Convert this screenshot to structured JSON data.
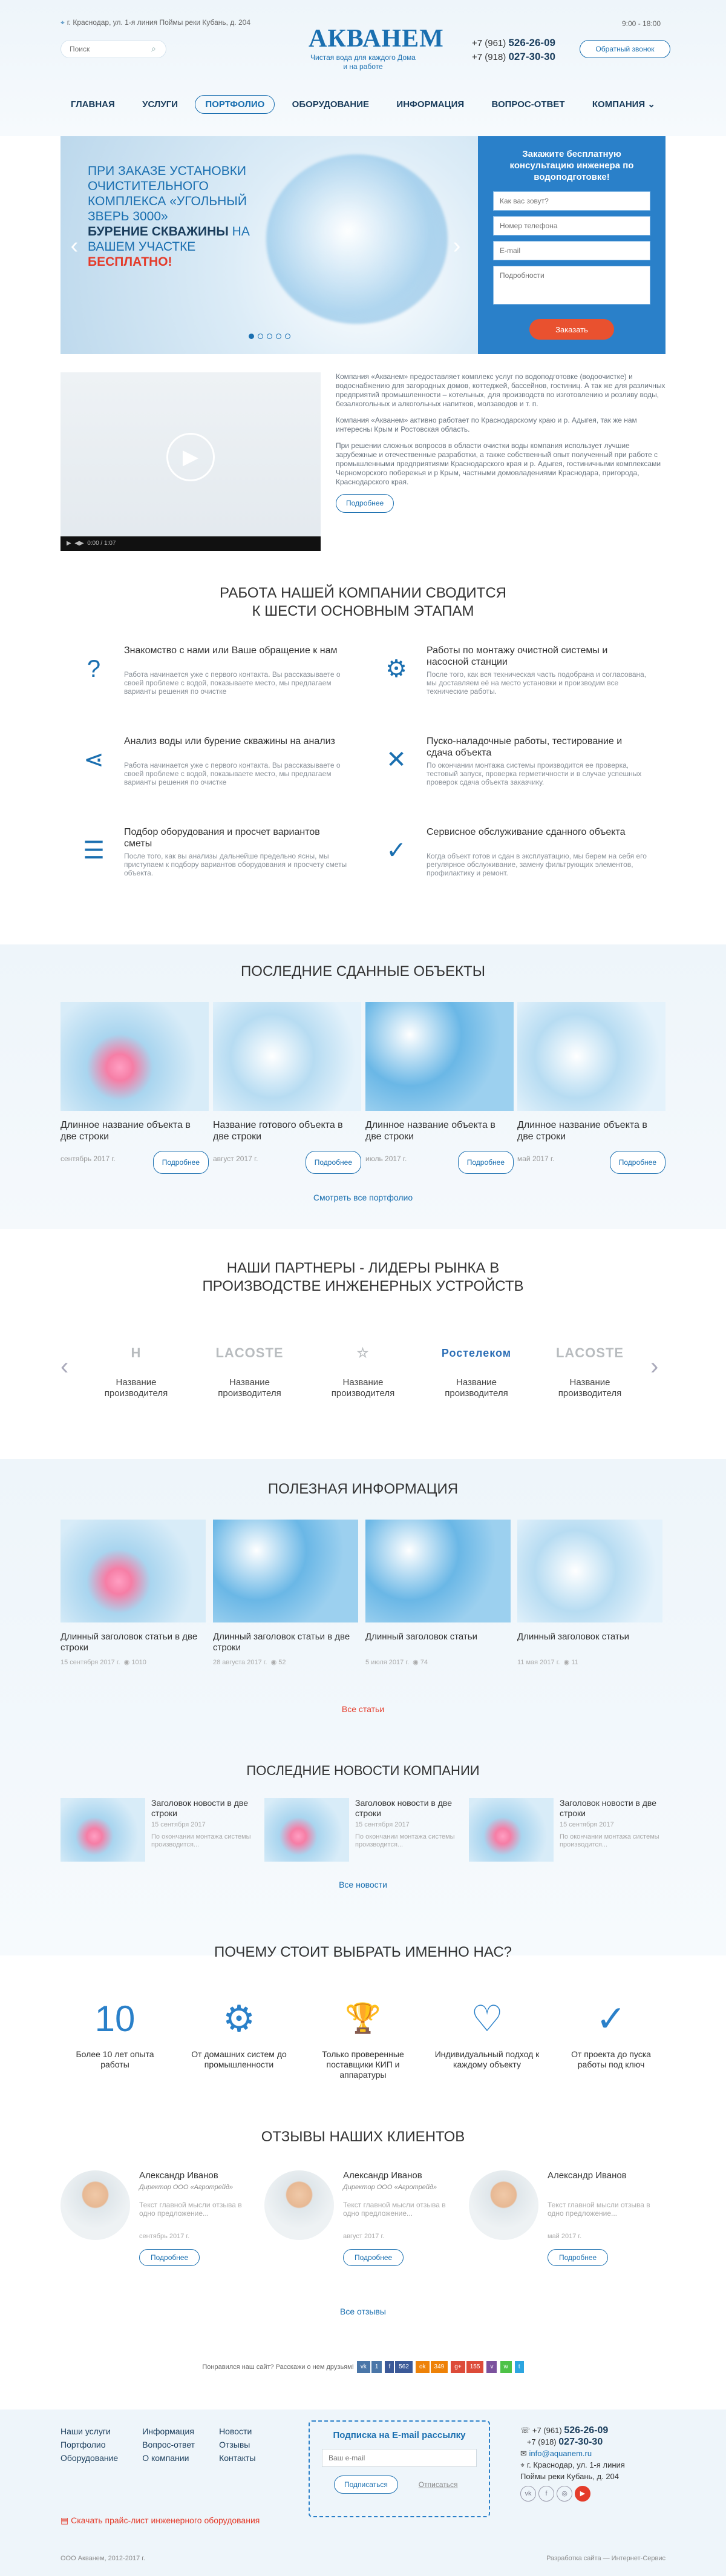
{
  "header": {
    "address": "г. Краснодар, ул. 1-я линия Поймы реки Кубань, д. 204",
    "search_placeholder": "Поиск",
    "logo": "АКВАНЕМ",
    "slogan": "Чистая вода для каждого Дома и на работе",
    "phone1_code": "+7 (961)",
    "phone1": "526-26-09",
    "phone2_code": "+7 (918)",
    "phone2": "027-30-30",
    "hours": "9:00 - 18:00",
    "callback": "Обратный звонок",
    "nav": [
      "ГЛАВНАЯ",
      "УСЛУГИ",
      "ПОРТФОЛИО",
      "ОБОРУДОВАНИЕ",
      "ИНФОРМАЦИЯ",
      "ВОПРОС-ОТВЕТ",
      "КОМПАНИЯ ⌄"
    ]
  },
  "hero": {
    "line1": "ПРИ ЗАКАЗЕ УСТАНОВКИ ОЧИСТИТЕЛЬНОГО КОМПЛЕКСА «УГОЛЬНЫЙ ЗВЕРЬ 3000»",
    "line2": "БУРЕНИЕ СКВАЖИНЫ",
    "line3": " НА ВАШЕМ УЧАСТКЕ",
    "line4": "БЕСПЛАТНО!",
    "form_title": "Закажите бесплатную консультацию инженера по водоподготовке!",
    "f_name": "Как вас зовут?",
    "f_phone": "Номер телефона",
    "f_email": "E-mail",
    "f_details": "Подробности",
    "f_submit": "Заказать"
  },
  "about": {
    "p1": "Компания «Акванем» предоставляет комплекс услуг по водоподготовке (водоочистке) и водоснабжению для загородных домов, коттеджей, бассейнов, гостиниц. А так же для различных предприятий промышленности – котельных, для производств по изготовлению и розливу воды, безалкогольных и алкогольных напитков, молзаводов и т. п.",
    "p2": "Компания «Акванем» активно работает по Краснодарскому краю и р. Адыгея, так же нам интересны Крым и Ростовская область.",
    "p3": "При решении сложных вопросов в области очистки воды компания использует лучшие зарубежные и отечественные разработки, а также собственный опыт полученный при работе с промышленными предприятиями Краснодарского края и р. Адыгея, гостиничными комплексами Черноморского побережья и р Крым, частными домовладениями Краснодара, пригорода, Краснодарского края.",
    "more": "Подробнее",
    "video_time": "0:00 / 1:07"
  },
  "stages": {
    "title1": "РАБОТА НАШЕЙ КОМПАНИИ СВОДИТСЯ",
    "title2": "К ШЕСТИ ОСНОВНЫМ ЭТАПАМ",
    "items": [
      {
        "title": "Знакомство с нами или Ваше обращение к нам",
        "text": "Работа начинается уже с первого контакта. Вы рассказываете о своей проблеме с водой, показываете место, мы предлагаем варианты решения по очистке",
        "icon": "question-icon"
      },
      {
        "title": "Работы по монтажу очистной системы и насосной станции",
        "text": "После того, как вся техническая часть подобрана и согласована, мы доставляем её на место установки и производим все технические работы.",
        "icon": "gear-icon"
      },
      {
        "title": "Анализ воды или бурение скважины на анализ",
        "text": "Работа начинается уже с первого контакта. Вы рассказываете о своей проблеме с водой, показываете место, мы предлагаем варианты решения по очистке",
        "icon": "share-icon"
      },
      {
        "title": "Пуско-наладочные работы, тестирование и сдача объекта",
        "text": "По окончании монтажа системы производится ее проверка, тестовый запуск, проверка герметичности и в случае успешных проверок сдача объекта заказчику.",
        "icon": "tools-icon"
      },
      {
        "title": "Подбор оборудования и просчет вариантов сметы",
        "text": "После того, как вы анализы дальнейше предельно ясны, мы приступаем к подбору вариантов оборудования и просчету сметы объекта.",
        "icon": "clipboard-icon"
      },
      {
        "title": "Сервисное обслуживание сданного объекта",
        "text": "Когда объект готов и сдан в эксплуатацию, мы берем на себя его регулярное обслуживание, замену фильтрующих элементов, профилактику и ремонт.",
        "icon": "check-circle-icon"
      }
    ]
  },
  "objects": {
    "title": "ПОСЛЕДНИЕ СДАННЫЕ ОБЪЕКТЫ",
    "items": [
      {
        "title": "Длинное название объекта в две строки",
        "date": "сентябрь 2017 г.",
        "btn": "Подробнее"
      },
      {
        "title": "Название готового объекта в две строки",
        "date": "август 2017 г.",
        "btn": "Подробнее"
      },
      {
        "title": "Длинное название объекта в две строки",
        "date": "июль 2017 г.",
        "btn": "Подробнее"
      },
      {
        "title": "Длинное название объекта в две строки",
        "date": "май 2017 г.",
        "btn": "Подробнее"
      }
    ],
    "all": "Смотреть все портфолио"
  },
  "partners": {
    "title1": "НАШИ ПАРТНЕРЫ - ЛИДЕРЫ РЫНКА В",
    "title2": "ПРОИЗВОДСТВЕ ИНЖЕНЕРНЫХ УСТРОЙСТВ",
    "items": [
      {
        "logo": "H",
        "name": "Название производителя"
      },
      {
        "logo": "LACOSTE",
        "name": "Название производителя"
      },
      {
        "logo": "☆",
        "name": "Название производителя"
      },
      {
        "logo": "Ростелеком",
        "name": "Название производителя"
      },
      {
        "logo": "LACOSTE",
        "name": "Название производителя"
      }
    ]
  },
  "info": {
    "title": "ПОЛЕЗНАЯ ИНФОРМАЦИЯ",
    "items": [
      {
        "title": "Длинный заголовок статьи в две строки",
        "date": "15 сентября 2017 г.",
        "views": "1010"
      },
      {
        "title": "Длинный заголовок статьи в две строки",
        "date": "28 августа 2017 г.",
        "views": "52"
      },
      {
        "title": "Длинный заголовок статьи",
        "date": "5 июля 2017 г.",
        "views": "74"
      },
      {
        "title": "Длинный заголовок статьи",
        "date": "11 мая 2017 г.",
        "views": "11"
      }
    ],
    "all": "Все статьи"
  },
  "news": {
    "title": "ПОСЛЕДНИЕ НОВОСТИ КОМПАНИИ",
    "items": [
      {
        "title": "Заголовок новости в две строки",
        "date": "15 сентября 2017",
        "text": "По окончании монтажа системы производится..."
      },
      {
        "title": "Заголовок новости в две строки",
        "date": "15 сентября 2017",
        "text": "По окончании монтажа системы производится..."
      },
      {
        "title": "Заголовок новости в две строки",
        "date": "15 сентября 2017",
        "text": "По окончании монтажа системы производится..."
      }
    ],
    "all": "Все новости"
  },
  "why": {
    "title": "ПОЧЕМУ СТОИТ ВЫБРАТЬ ИМЕННО НАС?",
    "items": [
      {
        "icon": "10",
        "text": "Более 10 лет опыта работы"
      },
      {
        "icon": "⚙",
        "text": "От домашних систем до промышленности"
      },
      {
        "icon": "🏆",
        "text": "Только проверенные поставщики КИП и аппаратуры"
      },
      {
        "icon": "♡",
        "text": "Индивидуальный подход к каждому объекту"
      },
      {
        "icon": "✓",
        "text": "От проекта до пуска работы под ключ"
      }
    ]
  },
  "reviews": {
    "title": "ОТЗЫВЫ НАШИХ КЛИЕНТОВ",
    "items": [
      {
        "name": "Александр Иванов",
        "role": "Директор ООО «Агротрейд»",
        "text": "Текст главной мысли отзыва в одно предложение...",
        "date": "сентябрь 2017 г.",
        "btn": "Подробнее"
      },
      {
        "name": "Александр Иванов",
        "role": "Директор ООО «Агротрейд»",
        "text": "Текст главной мысли отзыва в одно предложение...",
        "date": "август 2017 г.",
        "btn": "Подробнее"
      },
      {
        "name": "Александр Иванов",
        "role": "",
        "text": "Текст главной мысли отзыва в одно предложение...",
        "date": "май 2017 г.",
        "btn": "Подробнее"
      }
    ],
    "all": "Все отзывы"
  },
  "share": {
    "text": "Понравился наш сайт? Расскажи о нем друзьям!",
    "counts": [
      "1",
      "562",
      "349",
      "155"
    ]
  },
  "footer": {
    "col1": [
      "Наши услуги",
      "Портфолио",
      "Оборудование"
    ],
    "col2": [
      "Информация",
      "Вопрос-ответ",
      "О компании"
    ],
    "col3": [
      "Новости",
      "Отзывы",
      "Контакты"
    ],
    "sub_title": "Подписка на E-mail рассылку",
    "sub_placeholder": "Ваш e-mail",
    "sub_btn": "Подписаться",
    "unsub": "Отписаться",
    "phone1_code": "+7 (961)",
    "phone1": "526-26-09",
    "phone2_code": "+7 (918)",
    "phone2": "027-30-30",
    "email": "info@aquanem.ru",
    "address": "г. Краснодар, ул. 1-я линия Поймы реки Кубань, д. 204",
    "pdf": "Скачать прайс-лист инженерного оборудования",
    "copyright": "ООО Акванем, 2012-2017 г.",
    "dev": "Разработка сайта — Интернет-Сервис"
  }
}
